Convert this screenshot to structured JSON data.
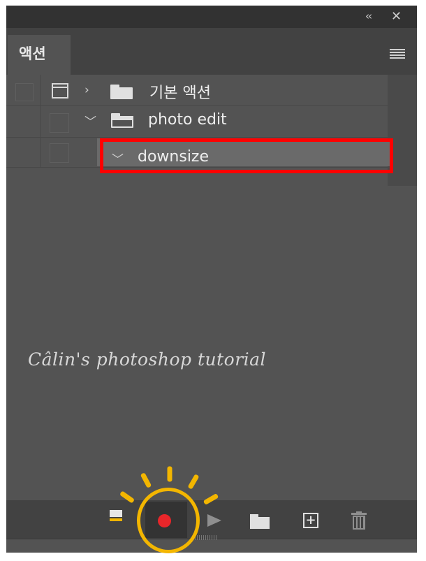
{
  "panel": {
    "tab_label": "액션",
    "collapse_glyph": "‹‹",
    "close_glyph": "✕"
  },
  "actions": [
    {
      "name": "기본 액션",
      "type": "set",
      "expanded": false,
      "depth": 0
    },
    {
      "name": "photo edit",
      "type": "set",
      "expanded": true,
      "depth": 1
    },
    {
      "name": "downsize",
      "type": "action",
      "expanded": true,
      "depth": 2,
      "selected": true
    }
  ],
  "watermark": "Câlin's photoshop tutorial",
  "toolbar": {
    "icons": [
      "stop-icon",
      "record-icon",
      "play-icon",
      "new-set-icon",
      "new-action-icon",
      "trash-icon"
    ],
    "add_glyph": "+"
  },
  "colors": {
    "panel_bg": "#535353",
    "highlight_red": "#ff0000",
    "record_red": "#e8262a",
    "annotation_yellow": "#f3b600"
  }
}
